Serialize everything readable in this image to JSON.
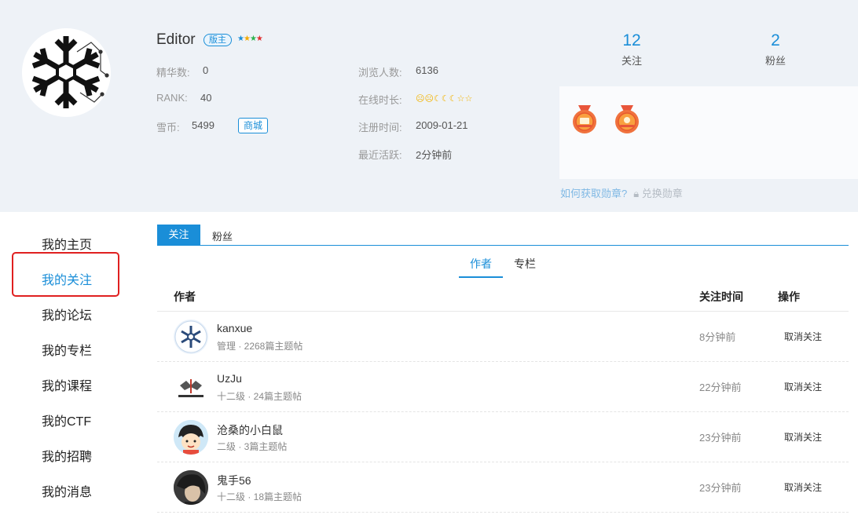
{
  "profile": {
    "username": "Editor",
    "role": "版主",
    "essence_label": "精华数:",
    "essence_value": "0",
    "rank_label": "RANK:",
    "rank_value": "40",
    "coins_label": "雪币:",
    "coins_value": "5499",
    "shop_label": "商城",
    "views_label": "浏览人数:",
    "views_value": "6136",
    "online_label": "在线时长:",
    "registered_label": "注册时间:",
    "registered_value": "2009-01-21",
    "last_active_label": "最近活跃:",
    "last_active_value": "2分钟前"
  },
  "counts": {
    "following_num": "12",
    "following_label": "关注",
    "fans_num": "2",
    "fans_label": "粉丝"
  },
  "medals": {
    "how_label": "如何获取勋章?",
    "redeem_label": "兑换勋章"
  },
  "sidebar": {
    "items": [
      {
        "label": "我的主页"
      },
      {
        "label": "我的关注"
      },
      {
        "label": "我的论坛"
      },
      {
        "label": "我的专栏"
      },
      {
        "label": "我的课程"
      },
      {
        "label": "我的CTF"
      },
      {
        "label": "我的招聘"
      },
      {
        "label": "我的消息"
      }
    ],
    "active_index": 1
  },
  "tabs": {
    "follow": "关注",
    "fans": "粉丝"
  },
  "subtabs": {
    "authors": "作者",
    "columns": "专栏"
  },
  "table": {
    "col_author": "作者",
    "col_time": "关注时间",
    "col_action": "操作",
    "rows": [
      {
        "name": "kanxue",
        "meta": "管理 · 2268篇主题帖",
        "time": "8分钟前",
        "action": "取消关注"
      },
      {
        "name": "UzJu",
        "meta": "十二级 · 24篇主题帖",
        "time": "22分钟前",
        "action": "取消关注"
      },
      {
        "name": "沧桑的小白鼠",
        "meta": "二级 · 3篇主题帖",
        "time": "23分钟前",
        "action": "取消关注"
      },
      {
        "name": "鬼手56",
        "meta": "十二级 · 18篇主题帖",
        "time": "23分钟前",
        "action": "取消关注"
      }
    ]
  },
  "colors": {
    "accent": "#1a8ed8",
    "header_bg": "#eef2f7",
    "highlight_box": "#e02020"
  }
}
